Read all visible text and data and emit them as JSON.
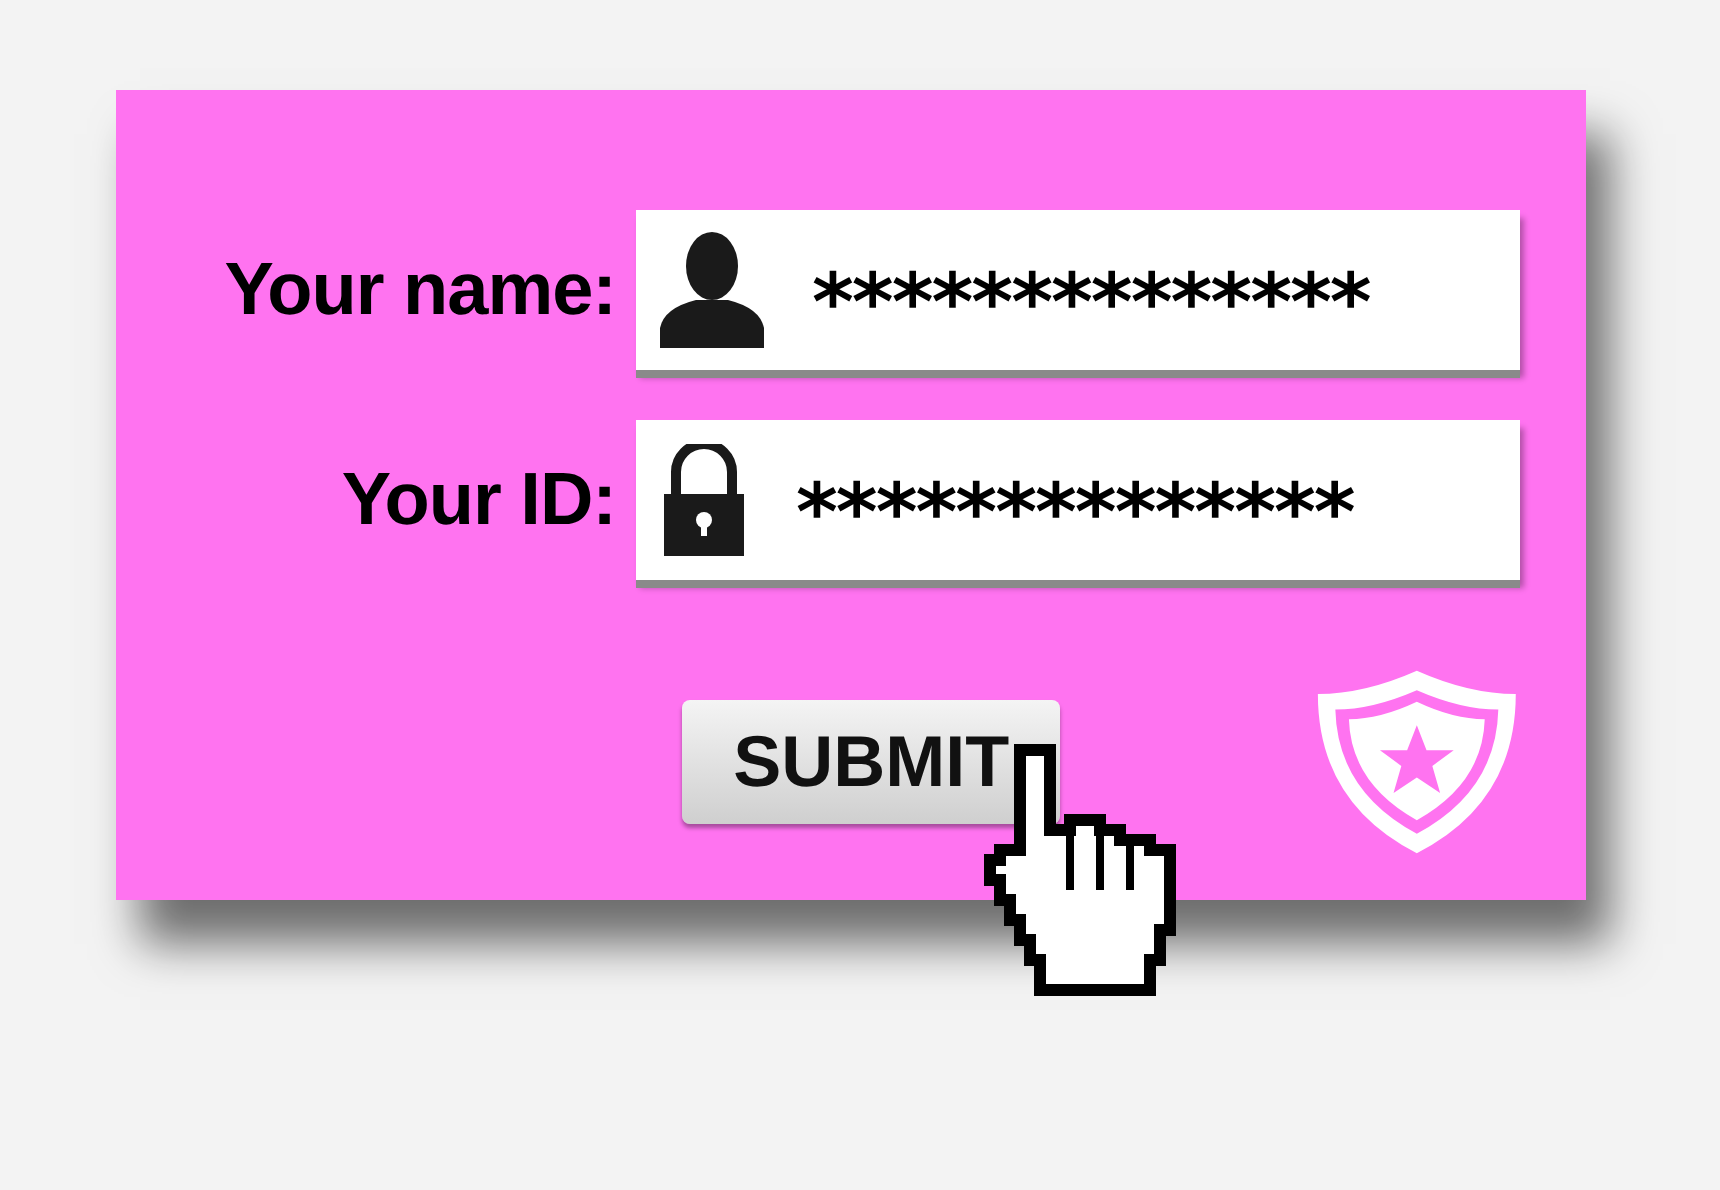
{
  "form": {
    "fields": [
      {
        "label": "Your name:",
        "kind": "person",
        "value": "**************"
      },
      {
        "label": "Your ID:",
        "kind": "lock",
        "value": "**************"
      }
    ],
    "submit": {
      "label": "SUBMIT"
    }
  }
}
